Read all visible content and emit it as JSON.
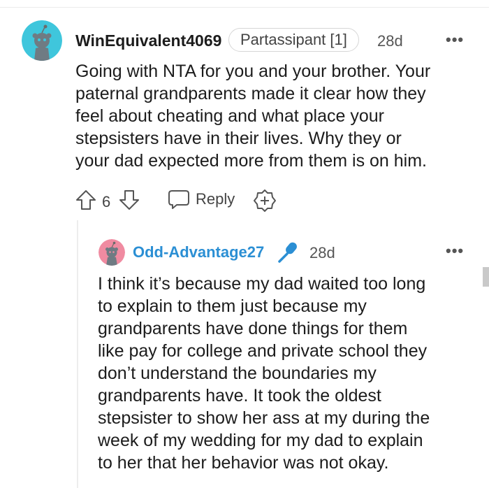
{
  "colors": {
    "avatar_bg_1": "#3fc6dc",
    "avatar_bg_2": "#f08ba1",
    "username_blue": "#2b8fd4",
    "mic_blue": "#2b8fd4"
  },
  "comment": {
    "username": "WinEquivalent4069",
    "flair": "Partassipant [1]",
    "age": "28d",
    "more": "•••",
    "body_lines": [
      "Going with NTA for you and your brother. Your",
      "paternal grandparents made it clear how they",
      "feel about cheating and what place your",
      "stepsisters have in their lives. Why they or",
      "your dad expected more from them is on him."
    ],
    "votes": "6",
    "reply_label": "Reply",
    "icons": [
      "upvote-icon",
      "downvote-icon",
      "comment-bubble-icon",
      "award-plus-icon",
      "more-options-icon"
    ]
  },
  "reply": {
    "username": "Odd-Advantage27",
    "age": "28d",
    "more": "•••",
    "badge_icon": "microphone-icon",
    "body_lines": [
      "I think it’s because my dad waited too long",
      "to explain to them just because my",
      "grandparents have done things for them",
      "like pay for college and private school they",
      "don’t understand the boundaries my",
      "grandparents have. It took the oldest",
      "stepsister to show her ass at my during the",
      "week of my wedding for my dad to explain",
      "to her that her behavior was not okay."
    ]
  }
}
